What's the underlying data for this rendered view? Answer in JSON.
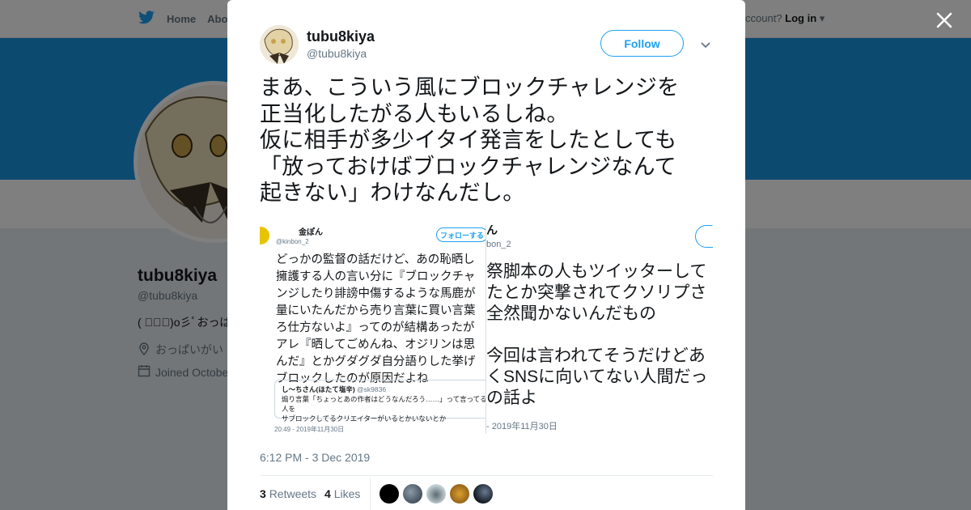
{
  "background": {
    "nav": {
      "home": "Home",
      "about": "Abo"
    },
    "login_prompt": "ccount?",
    "login_label": "Log in",
    "profile_name": "tubu8kiya",
    "profile_handle": "@tubu8kiya",
    "bio": "( ﾟ∀ﾟ)o彡ﾟおっぱ",
    "location": "おっぱいがい",
    "joined": "Joined Octobe"
  },
  "tweet": {
    "author_name": "tubu8kiya",
    "author_handle": "@tubu8kiya",
    "follow_label": "Follow",
    "text": "まあ、こういう風にブロックチャレンジを\n正当化したがる人もいるしね。\n仮に相手が多少イタイ発言をしたとしても\n「放っておけばブロックチャレンジなんて\n起きない」わけなんだし。",
    "timestamp": "6:12 PM - 3 Dec 2019",
    "retweets_count": "3",
    "retweets_label": "Retweets",
    "likes_count": "4",
    "likes_label": "Likes"
  },
  "media": [
    {
      "name": "金ぽん",
      "handle": "@kinbon_2",
      "follow": "フォローする",
      "body": "どっかの監督の話だけど、あの恥晒し\n擁護する人の言い分に『ブロックチャ\nンジしたり誹謗中傷するような馬鹿が\n量にいたんだから売り言葉に買い言葉\nろ仕方ないよ』ってのが結構あったが\nアレ『晒してごめんね、オジリンは思\nんだ』とかグダグダ自分語りした挙げ\nブロックしたのが原因だよね",
      "quote_name": "し～ちさん(ほたて塩辛)",
      "quote_handle": "@sk9836",
      "quote_text": "煽り言葉「ちょっとあの作者はどうなんだろう……」って言ってる人を\nサブロックしてるクリエイターがいるとかいないとか",
      "date": "20:49 - 2019年11月30日"
    },
    {
      "name": "ん",
      "handle": "bon_2",
      "body": "祭脚本の人もツイッターして\nたとか突撃されてクソリプさ\n全然聞かないんだもの\n\n今回は言われてそうだけどあ\nくSNSに向いてない人間だっ\nの話よ",
      "date": "- 2019年11月30日"
    }
  ],
  "colors": {
    "accent": "#1da1f2",
    "banner": "#1b95e0",
    "overlay": "rgba(0,0,0,0.5)"
  },
  "icons": [
    "twitter-bird-icon",
    "close-icon",
    "chevron-down-icon",
    "location-icon",
    "calendar-icon"
  ]
}
